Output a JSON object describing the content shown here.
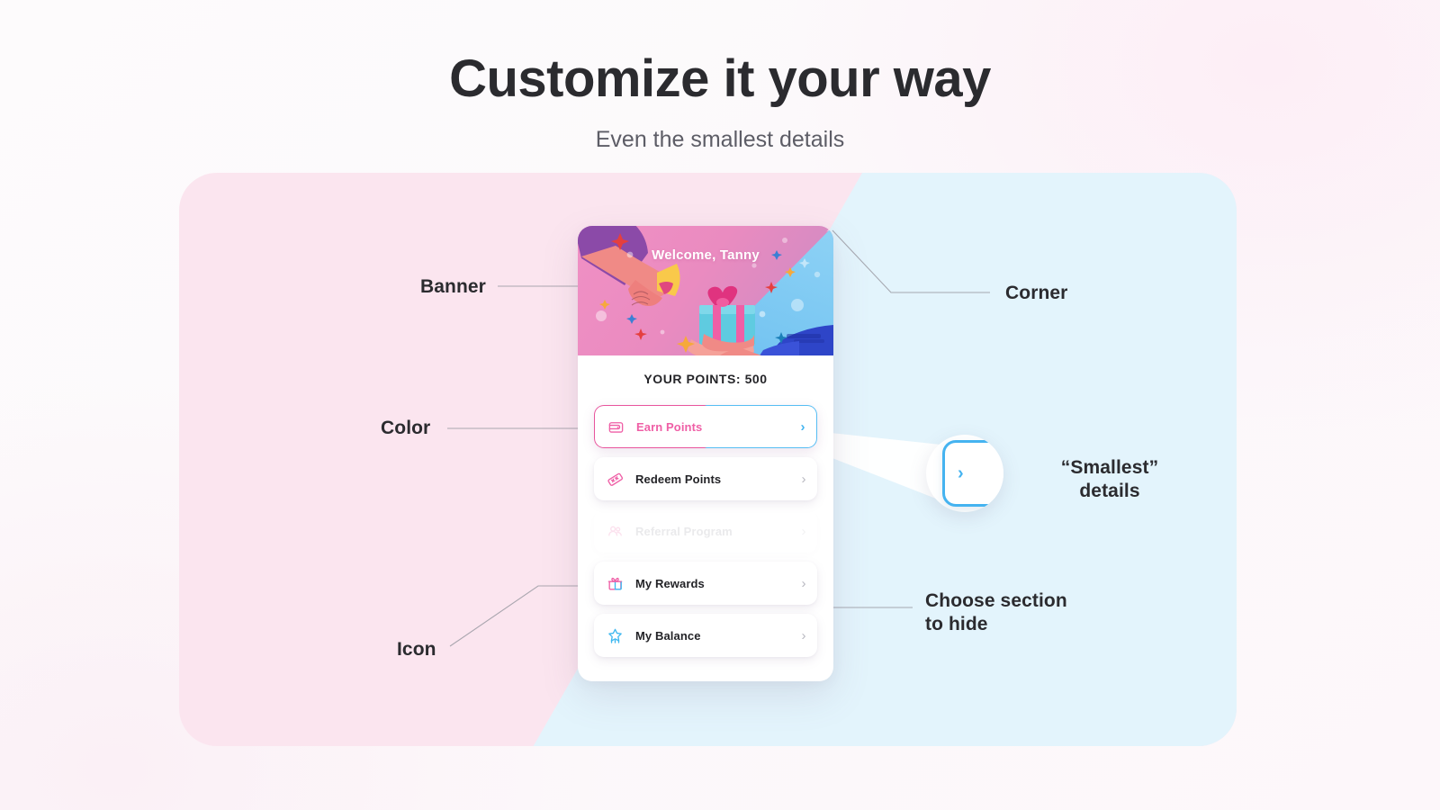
{
  "header": {
    "title": "Customize it your way",
    "subtitle": "Even the smallest details"
  },
  "colors": {
    "panel_pink": "#fbe5ef",
    "panel_blue": "#e3f4fc",
    "banner_pink": "#ea8bc0",
    "banner_blue": "#78c6f2",
    "accent_pink": "#e8559d",
    "accent_blue": "#45b3f0",
    "text_dark": "#2b2b2f"
  },
  "card": {
    "banner": {
      "welcome_text": "Welcome, Tanny"
    },
    "points_label": "YOUR POINTS: 500",
    "menu": [
      {
        "label": "Earn Points",
        "icon": "wallet-icon",
        "state": "active"
      },
      {
        "label": "Redeem Points",
        "icon": "ticket-icon",
        "state": "normal"
      },
      {
        "label": "Referral Program",
        "icon": "users-icon",
        "state": "hidden"
      },
      {
        "label": "My Rewards",
        "icon": "gift-icon",
        "state": "normal"
      },
      {
        "label": "My Balance",
        "icon": "star-badge-icon",
        "state": "normal"
      }
    ],
    "chevron_glyph": "›"
  },
  "magnifier": {
    "chevron_glyph": "›"
  },
  "annotations": {
    "banner": "Banner",
    "color": "Color",
    "icon": "Icon",
    "corner": "Corner",
    "smallest_line1": "“Smallest”",
    "smallest_line2": "details",
    "choose_line1": "Choose section",
    "choose_line2": "to hide"
  }
}
